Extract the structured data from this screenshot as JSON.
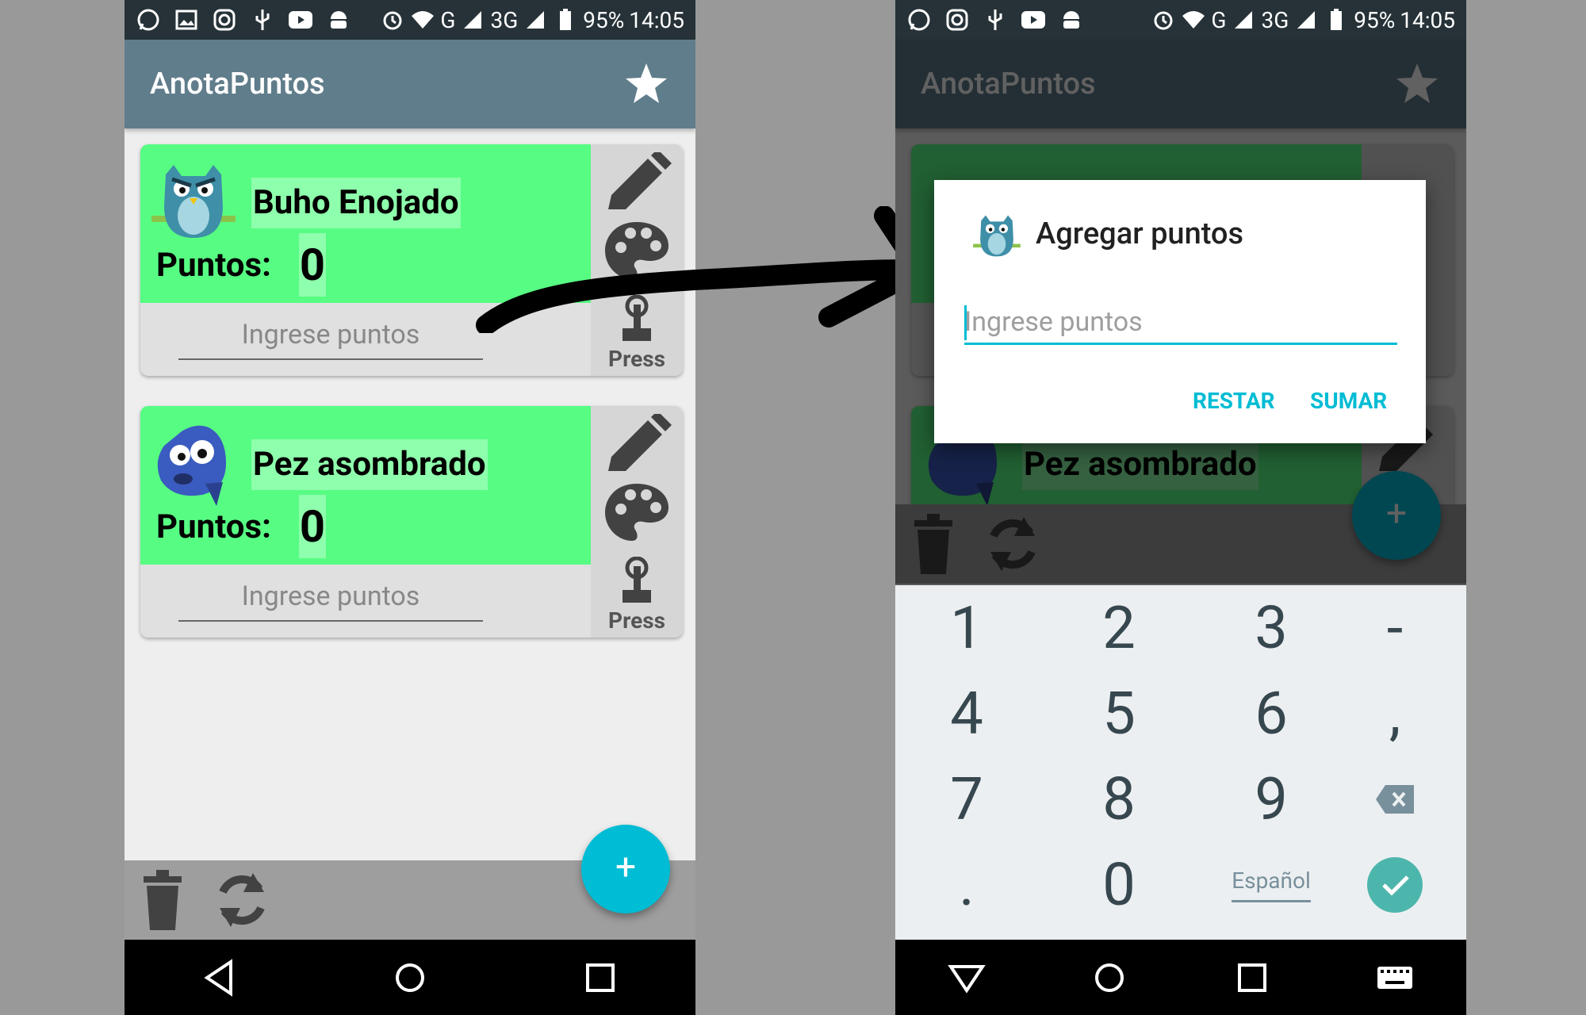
{
  "status_bar": {
    "battery": "95%",
    "time": "14:05",
    "net_g": "G",
    "net_3g": "3G"
  },
  "app": {
    "title": "AnotaPuntos"
  },
  "cards": [
    {
      "name": "Buho Enojado",
      "points_label": "Puntos:",
      "points_value": "0",
      "input_placeholder": "Ingrese puntos",
      "press_label": "Press",
      "avatar": "owl-avatar"
    },
    {
      "name": "Pez asombrado",
      "points_label": "Puntos:",
      "points_value": "0",
      "input_placeholder": "Ingrese puntos",
      "press_label": "Press",
      "avatar": "fish-avatar"
    }
  ],
  "fab": {
    "label": "+"
  },
  "dialog": {
    "title": "Agregar puntos",
    "input_placeholder": "Ingrese puntos",
    "btn_restar": "RESTAR",
    "btn_sumar": "SUMAR"
  },
  "keyboard": {
    "keys": [
      "1",
      "2",
      "3",
      "-",
      "4",
      "5",
      "6",
      ",",
      "7",
      "8",
      "9",
      ".",
      "0"
    ],
    "lang_label": "Español"
  },
  "colors": {
    "appbar": "#607d8b",
    "card_green": "#57fd83",
    "accent": "#00bcd4",
    "statusbar": "#263238"
  },
  "icons": [
    "whatsapp-icon",
    "gallery-icon",
    "instagram-icon",
    "usb-icon",
    "youtube-icon",
    "android-icon",
    "alarm-icon",
    "wifi-icon",
    "signal-icon",
    "battery-icon",
    "star-icon",
    "edit-icon",
    "palette-icon",
    "press-icon",
    "trash-icon",
    "refresh-icon",
    "back-icon",
    "home-icon",
    "recents-icon",
    "backspace-icon",
    "check-icon",
    "keyboard-icon"
  ]
}
